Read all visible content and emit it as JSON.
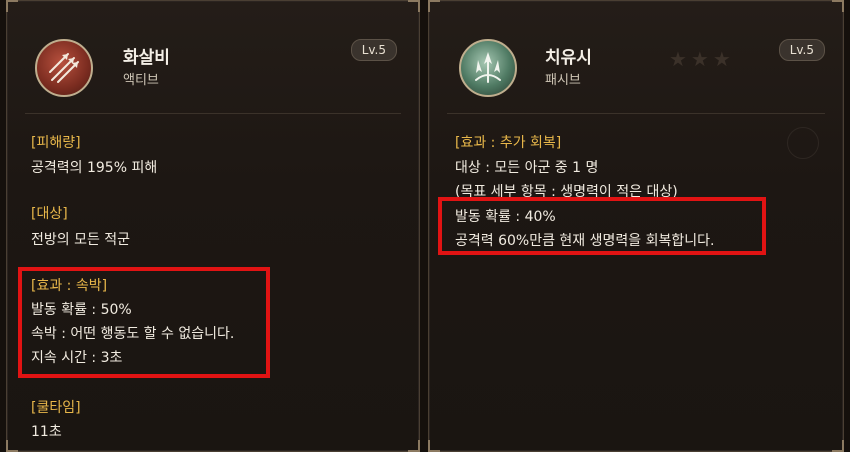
{
  "left_card": {
    "skill_name": "화살비",
    "skill_type": "액티브",
    "level": "Lv.5",
    "icon": "arrow-rain-icon",
    "sections": [
      {
        "header": "[피해량]",
        "lines": [
          "공격력의 195% 피해"
        ]
      },
      {
        "header": "[대상]",
        "lines": [
          "전방의 모든 적군"
        ]
      },
      {
        "header": "[효과 : 속박]",
        "lines": [
          "발동 확률 : 50%",
          "속박 : 어떤 행동도 할 수 없습니다.",
          "지속 시간 : 3초"
        ]
      },
      {
        "header": "[쿨타임]",
        "lines": [
          "11초"
        ]
      }
    ]
  },
  "right_card": {
    "skill_name": "치유시",
    "skill_type": "패시브",
    "level": "Lv.5",
    "icon": "healing-arrow-icon",
    "header": "[효과 : 추가 회복]",
    "lines": [
      "대상 : 모든 아군 중 1 명",
      "(목표 세부 항목 : 생명력이 적은 대상)",
      "발동 확률 : 40%",
      "공격력 60%만큼 현재 생명력을 회복합니다."
    ]
  },
  "highlight_color": "#e11313",
  "header_color": "#e8b74a"
}
